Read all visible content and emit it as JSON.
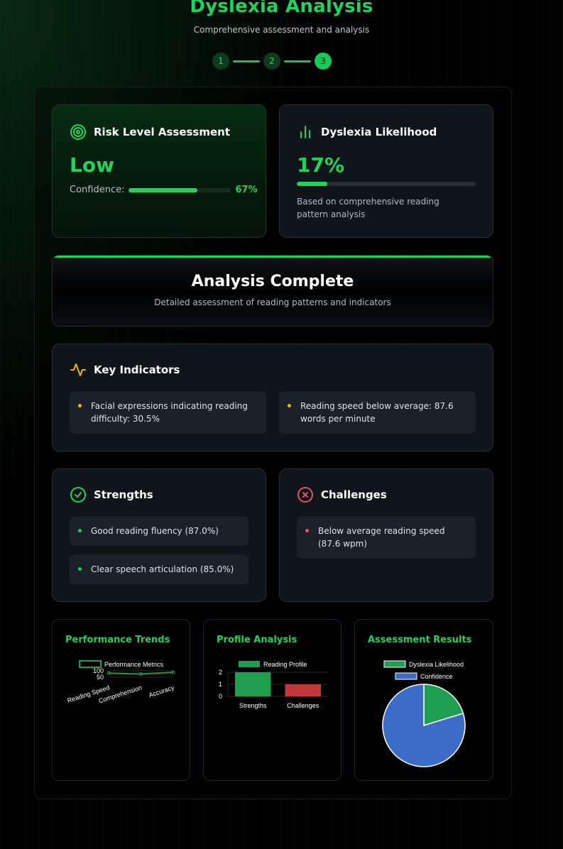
{
  "header": {
    "title": "Dyslexia Analysis",
    "subtitle": "Comprehensive assessment and analysis"
  },
  "steps": [
    "1",
    "2",
    "3"
  ],
  "risk": {
    "title": "Risk Level Assessment",
    "level": "Low",
    "confidence_label": "Confidence:",
    "confidence_value": "67%",
    "confidence": 0.67
  },
  "likelihood": {
    "title": "Dyslexia Likelihood",
    "value": "17%",
    "fraction": 0.17,
    "description": "Based on comprehensive reading pattern analysis"
  },
  "complete": {
    "title": "Analysis Complete",
    "subtitle": "Detailed assessment of reading patterns and indicators"
  },
  "indicators": {
    "title": "Key Indicators",
    "items": [
      "Facial expressions indicating reading difficulty: 30.5%",
      "Reading speed below average: 87.6 words per minute"
    ]
  },
  "strengths": {
    "title": "Strengths",
    "items": [
      "Good reading fluency (87.0%)",
      "Clear speech articulation (85.0%)"
    ]
  },
  "challenges": {
    "title": "Challenges",
    "items": [
      "Below average reading speed (87.6 wpm)"
    ]
  },
  "colors": {
    "accent": "#1fd35c",
    "warning": "#f2b705",
    "danger": "#e05561",
    "strength_bar": "#1e9e4e",
    "challenge_bar": "#c0383a",
    "pie_blue": "#3a6cc8"
  },
  "chart_data": [
    {
      "type": "line",
      "title": "Performance Trends",
      "legend": [
        "Performance Metrics"
      ],
      "categories": [
        "Reading Speed",
        "Comprehension",
        "Accuracy"
      ],
      "series": [
        {
          "name": "Performance Metrics",
          "values": [
            82,
            75,
            88
          ]
        }
      ],
      "yticks": [
        "100",
        "50"
      ],
      "ylim": [
        0,
        100
      ]
    },
    {
      "type": "bar",
      "title": "Profile Analysis",
      "legend": [
        "Reading Profile"
      ],
      "categories": [
        "Strengths",
        "Challenges"
      ],
      "series": [
        {
          "name": "Reading Profile",
          "values": [
            2,
            1
          ]
        }
      ],
      "yticks": [
        "2",
        "1",
        "0"
      ],
      "ylim": [
        0,
        2
      ]
    },
    {
      "type": "pie",
      "title": "Assessment Results",
      "legend": [
        "Dyslexia Likelihood",
        "Confidence"
      ],
      "values": [
        17,
        67
      ]
    }
  ]
}
